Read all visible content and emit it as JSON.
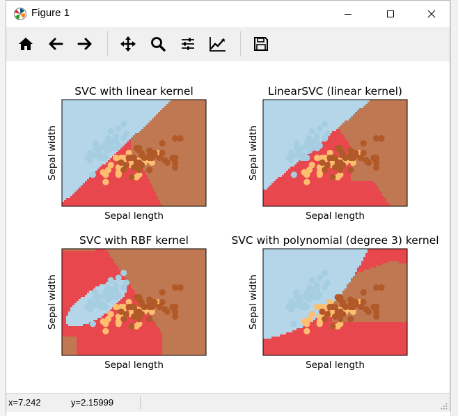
{
  "window": {
    "title": "Figure 1",
    "controls": [
      "minimize",
      "maximize",
      "close"
    ]
  },
  "toolbar": {
    "buttons": [
      {
        "name": "home",
        "icon": "home-icon"
      },
      {
        "name": "back",
        "icon": "arrow-left-icon"
      },
      {
        "name": "forward",
        "icon": "arrow-right-icon"
      },
      {
        "name": "pan",
        "icon": "move-icon"
      },
      {
        "name": "zoom",
        "icon": "magnifier-icon"
      },
      {
        "name": "subplots",
        "icon": "sliders-icon"
      },
      {
        "name": "customize",
        "icon": "line-chart-icon"
      },
      {
        "name": "save",
        "icon": "floppy-disk-icon"
      }
    ]
  },
  "status": {
    "x": "x=7.242",
    "y": "y=2.15999"
  },
  "colors": {
    "class0": "#b5d6e8",
    "class1": "#e8474e",
    "class2": "#bf7851",
    "point0": "#a6cee3",
    "point1": "#fdbf6f",
    "point2": "#b15928",
    "point1_overlap": "#fb8a7a"
  },
  "chart_data": [
    {
      "type": "scatter",
      "title": "SVC with linear kernel",
      "xlabel": "Sepal length",
      "ylabel": "Sepal width",
      "kernel": "linear",
      "x_range": [
        3.3,
        8.9
      ],
      "y_range": [
        1.0,
        5.4
      ]
    },
    {
      "type": "scatter",
      "title": "LinearSVC (linear kernel)",
      "xlabel": "Sepal length",
      "ylabel": "Sepal width",
      "kernel": "linearsvc",
      "x_range": [
        3.3,
        8.9
      ],
      "y_range": [
        1.0,
        5.4
      ]
    },
    {
      "type": "scatter",
      "title": "SVC with RBF kernel",
      "xlabel": "Sepal length",
      "ylabel": "Sepal width",
      "kernel": "rbf",
      "x_range": [
        3.3,
        8.9
      ],
      "y_range": [
        1.0,
        5.4
      ]
    },
    {
      "type": "scatter",
      "title": "SVC with polynomial (degree 3) kernel",
      "xlabel": "Sepal length",
      "ylabel": "Sepal width",
      "kernel": "poly",
      "x_range": [
        3.3,
        8.9
      ],
      "y_range": [
        1.0,
        5.4
      ]
    }
  ],
  "points": [
    {
      "x": 4.9,
      "y": 3.0,
      "c": 0
    },
    {
      "x": 4.7,
      "y": 3.2,
      "c": 0
    },
    {
      "x": 4.6,
      "y": 3.1,
      "c": 0
    },
    {
      "x": 5.0,
      "y": 3.6,
      "c": 0
    },
    {
      "x": 5.4,
      "y": 3.9,
      "c": 0
    },
    {
      "x": 4.6,
      "y": 3.4,
      "c": 0
    },
    {
      "x": 5.0,
      "y": 3.4,
      "c": 0
    },
    {
      "x": 4.4,
      "y": 2.9,
      "c": 0
    },
    {
      "x": 4.9,
      "y": 3.1,
      "c": 0
    },
    {
      "x": 5.4,
      "y": 3.7,
      "c": 0
    },
    {
      "x": 4.8,
      "y": 3.4,
      "c": 0
    },
    {
      "x": 4.8,
      "y": 3.0,
      "c": 0
    },
    {
      "x": 4.3,
      "y": 3.0,
      "c": 0
    },
    {
      "x": 5.8,
      "y": 4.0,
      "c": 0
    },
    {
      "x": 5.7,
      "y": 4.4,
      "c": 0
    },
    {
      "x": 5.4,
      "y": 3.9,
      "c": 0
    },
    {
      "x": 5.1,
      "y": 3.5,
      "c": 0
    },
    {
      "x": 5.7,
      "y": 3.8,
      "c": 0
    },
    {
      "x": 5.1,
      "y": 3.8,
      "c": 0
    },
    {
      "x": 5.4,
      "y": 3.4,
      "c": 0
    },
    {
      "x": 5.1,
      "y": 3.7,
      "c": 0
    },
    {
      "x": 4.6,
      "y": 3.6,
      "c": 0
    },
    {
      "x": 5.1,
      "y": 3.3,
      "c": 0
    },
    {
      "x": 4.8,
      "y": 3.4,
      "c": 0
    },
    {
      "x": 5.0,
      "y": 3.0,
      "c": 0
    },
    {
      "x": 5.2,
      "y": 3.5,
      "c": 0
    },
    {
      "x": 5.2,
      "y": 3.4,
      "c": 0
    },
    {
      "x": 4.7,
      "y": 3.2,
      "c": 0
    },
    {
      "x": 5.4,
      "y": 3.4,
      "c": 0
    },
    {
      "x": 5.2,
      "y": 4.1,
      "c": 0
    },
    {
      "x": 5.5,
      "y": 4.2,
      "c": 0
    },
    {
      "x": 5.5,
      "y": 3.5,
      "c": 0
    },
    {
      "x": 4.4,
      "y": 3.0,
      "c": 0
    },
    {
      "x": 5.1,
      "y": 3.4,
      "c": 0
    },
    {
      "x": 5.0,
      "y": 3.5,
      "c": 0
    },
    {
      "x": 4.5,
      "y": 2.3,
      "c": 0
    },
    {
      "x": 4.4,
      "y": 3.2,
      "c": 0
    },
    {
      "x": 5.0,
      "y": 3.5,
      "c": 0
    },
    {
      "x": 5.1,
      "y": 3.8,
      "c": 0
    },
    {
      "x": 5.3,
      "y": 3.7,
      "c": 0
    },
    {
      "x": 7.0,
      "y": 3.2,
      "c": 1
    },
    {
      "x": 6.4,
      "y": 3.2,
      "c": 1
    },
    {
      "x": 6.9,
      "y": 3.1,
      "c": 1
    },
    {
      "x": 5.5,
      "y": 2.3,
      "c": 1
    },
    {
      "x": 6.5,
      "y": 2.8,
      "c": 1
    },
    {
      "x": 5.7,
      "y": 2.8,
      "c": 1
    },
    {
      "x": 6.3,
      "y": 3.3,
      "c": 1
    },
    {
      "x": 4.9,
      "y": 2.4,
      "c": 1
    },
    {
      "x": 6.6,
      "y": 2.9,
      "c": 1
    },
    {
      "x": 5.2,
      "y": 2.7,
      "c": 1
    },
    {
      "x": 5.0,
      "y": 2.0,
      "c": 1
    },
    {
      "x": 5.9,
      "y": 3.0,
      "c": 1
    },
    {
      "x": 6.0,
      "y": 2.2,
      "c": 1
    },
    {
      "x": 6.1,
      "y": 2.9,
      "c": 1
    },
    {
      "x": 5.6,
      "y": 2.9,
      "c": 1
    },
    {
      "x": 6.7,
      "y": 3.1,
      "c": 1
    },
    {
      "x": 5.6,
      "y": 3.0,
      "c": 1
    },
    {
      "x": 5.8,
      "y": 2.7,
      "c": 1
    },
    {
      "x": 6.2,
      "y": 2.2,
      "c": 1
    },
    {
      "x": 5.6,
      "y": 2.5,
      "c": 1
    },
    {
      "x": 5.9,
      "y": 3.2,
      "c": 1
    },
    {
      "x": 6.1,
      "y": 2.8,
      "c": 1
    },
    {
      "x": 6.3,
      "y": 2.5,
      "c": 1
    },
    {
      "x": 6.4,
      "y": 2.9,
      "c": 1
    },
    {
      "x": 6.8,
      "y": 2.8,
      "c": 1
    },
    {
      "x": 6.0,
      "y": 2.9,
      "c": 1
    },
    {
      "x": 5.7,
      "y": 2.6,
      "c": 1
    },
    {
      "x": 5.5,
      "y": 2.4,
      "c": 1
    },
    {
      "x": 5.8,
      "y": 2.7,
      "c": 1
    },
    {
      "x": 6.0,
      "y": 2.7,
      "c": 1
    },
    {
      "x": 5.4,
      "y": 3.0,
      "c": 1
    },
    {
      "x": 6.7,
      "y": 3.1,
      "c": 1
    },
    {
      "x": 6.3,
      "y": 2.3,
      "c": 1
    },
    {
      "x": 5.5,
      "y": 2.6,
      "c": 1
    },
    {
      "x": 6.1,
      "y": 3.0,
      "c": 1
    },
    {
      "x": 5.0,
      "y": 2.3,
      "c": 1
    },
    {
      "x": 5.7,
      "y": 3.0,
      "c": 1
    },
    {
      "x": 6.2,
      "y": 2.9,
      "c": 1
    },
    {
      "x": 5.1,
      "y": 2.5,
      "c": 1
    },
    {
      "x": 5.7,
      "y": 2.8,
      "c": 1
    },
    {
      "x": 6.3,
      "y": 3.3,
      "c": 2
    },
    {
      "x": 7.1,
      "y": 3.0,
      "c": 2
    },
    {
      "x": 6.5,
      "y": 3.0,
      "c": 2
    },
    {
      "x": 7.6,
      "y": 3.0,
      "c": 2
    },
    {
      "x": 7.3,
      "y": 2.9,
      "c": 2
    },
    {
      "x": 6.7,
      "y": 2.5,
      "c": 2
    },
    {
      "x": 7.2,
      "y": 3.6,
      "c": 2
    },
    {
      "x": 6.4,
      "y": 2.7,
      "c": 2
    },
    {
      "x": 6.8,
      "y": 3.0,
      "c": 2
    },
    {
      "x": 5.7,
      "y": 2.5,
      "c": 2
    },
    {
      "x": 6.4,
      "y": 3.2,
      "c": 2
    },
    {
      "x": 7.7,
      "y": 3.8,
      "c": 2
    },
    {
      "x": 7.7,
      "y": 2.6,
      "c": 2
    },
    {
      "x": 6.0,
      "y": 2.2,
      "c": 2
    },
    {
      "x": 6.9,
      "y": 3.2,
      "c": 2
    },
    {
      "x": 5.6,
      "y": 2.8,
      "c": 2
    },
    {
      "x": 7.7,
      "y": 2.8,
      "c": 2
    },
    {
      "x": 6.3,
      "y": 2.7,
      "c": 2
    },
    {
      "x": 6.7,
      "y": 3.3,
      "c": 2
    },
    {
      "x": 7.2,
      "y": 3.2,
      "c": 2
    },
    {
      "x": 6.2,
      "y": 2.8,
      "c": 2
    },
    {
      "x": 6.1,
      "y": 3.0,
      "c": 2
    },
    {
      "x": 7.4,
      "y": 2.8,
      "c": 2
    },
    {
      "x": 7.9,
      "y": 3.8,
      "c": 2
    },
    {
      "x": 6.3,
      "y": 2.8,
      "c": 2
    },
    {
      "x": 6.1,
      "y": 2.6,
      "c": 2
    },
    {
      "x": 7.7,
      "y": 3.0,
      "c": 2
    },
    {
      "x": 6.3,
      "y": 3.4,
      "c": 2
    },
    {
      "x": 6.4,
      "y": 3.1,
      "c": 2
    },
    {
      "x": 6.0,
      "y": 3.0,
      "c": 2
    },
    {
      "x": 6.9,
      "y": 3.1,
      "c": 2
    },
    {
      "x": 6.7,
      "y": 3.1,
      "c": 2
    },
    {
      "x": 5.8,
      "y": 2.7,
      "c": 2
    },
    {
      "x": 6.8,
      "y": 3.2,
      "c": 2
    },
    {
      "x": 6.7,
      "y": 3.0,
      "c": 2
    },
    {
      "x": 6.3,
      "y": 2.5,
      "c": 2
    },
    {
      "x": 6.5,
      "y": 3.0,
      "c": 2
    },
    {
      "x": 6.2,
      "y": 3.4,
      "c": 2
    },
    {
      "x": 5.9,
      "y": 3.0,
      "c": 2
    }
  ]
}
